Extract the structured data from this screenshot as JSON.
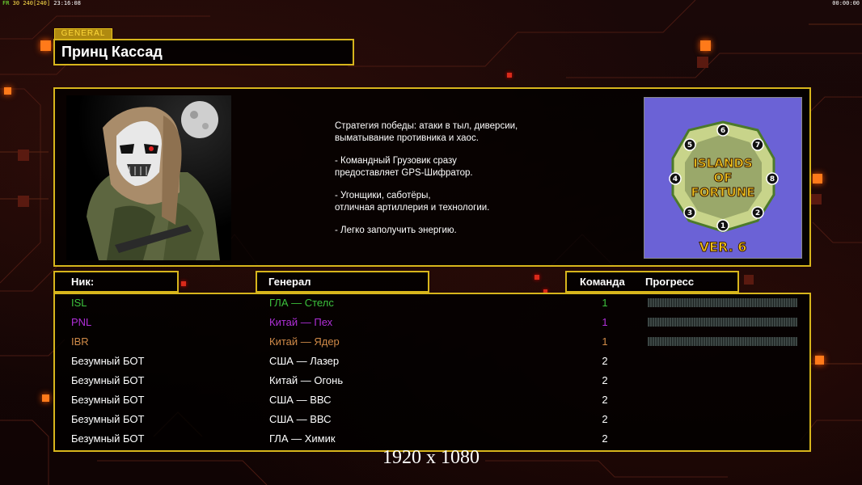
{
  "topbar": {
    "fps_label": "FR",
    "fps_value": "30",
    "fps_target": "240",
    "fps_max": "[240]",
    "clock_left": "23:16:08",
    "clock_right": "00:00:00"
  },
  "header": {
    "tag": "GENERAL",
    "title": "Принц Кассад"
  },
  "info": {
    "portrait_icon": "general-portrait-kassad",
    "strategy_lines": [
      "Стратегия победы: атаки в тыл, диверсии,\n выматывание противника и хаос.",
      "- Командный Грузовик сразу\nпредоставляет GPS-Шифратор.",
      "- Угонщики, саботёры,\nотличная артиллерия и технологии.",
      "- Легко заполучить энергию."
    ],
    "map": {
      "title_line1": "ISLANDS",
      "title_line2": "OF",
      "title_line3": "FORTUNE",
      "version": "VER. 6",
      "slots": [
        "1",
        "2",
        "3",
        "4",
        "5",
        "6",
        "7",
        "8"
      ]
    }
  },
  "columns": {
    "nick": "Ник:",
    "general": "Генерал",
    "team": "Команда",
    "progress": "Прогресс"
  },
  "players": [
    {
      "nick": "ISL",
      "general": "ГЛА — Стелс",
      "team": "1",
      "color": "#3cc23c",
      "progress": 0
    },
    {
      "nick": "PNL",
      "general": "Китай — Пех",
      "team": "1",
      "color": "#b12fd9",
      "progress": 0
    },
    {
      "nick": "IBR",
      "general": "Китай — Ядер",
      "team": "1",
      "color": "#d08a48",
      "progress": 0
    },
    {
      "nick": "Безумный БОТ",
      "general": "США — Лазер",
      "team": "2",
      "color": "#ffffff"
    },
    {
      "nick": "Безумный БОТ",
      "general": "Китай — Огонь",
      "team": "2",
      "color": "#ffffff"
    },
    {
      "nick": "Безумный БОТ",
      "general": "США — ВВС",
      "team": "2",
      "color": "#ffffff"
    },
    {
      "nick": "Безумный БОТ",
      "general": "США — ВВС",
      "team": "2",
      "color": "#ffffff"
    },
    {
      "nick": "Безумный БОТ",
      "general": "ГЛА — Химик",
      "team": "2",
      "color": "#ffffff"
    }
  ],
  "resolution_text": "1920 x 1080",
  "colors": {
    "frame": "#d7b51c",
    "accent_orange": "#ff7a1a",
    "background": "#120606"
  }
}
